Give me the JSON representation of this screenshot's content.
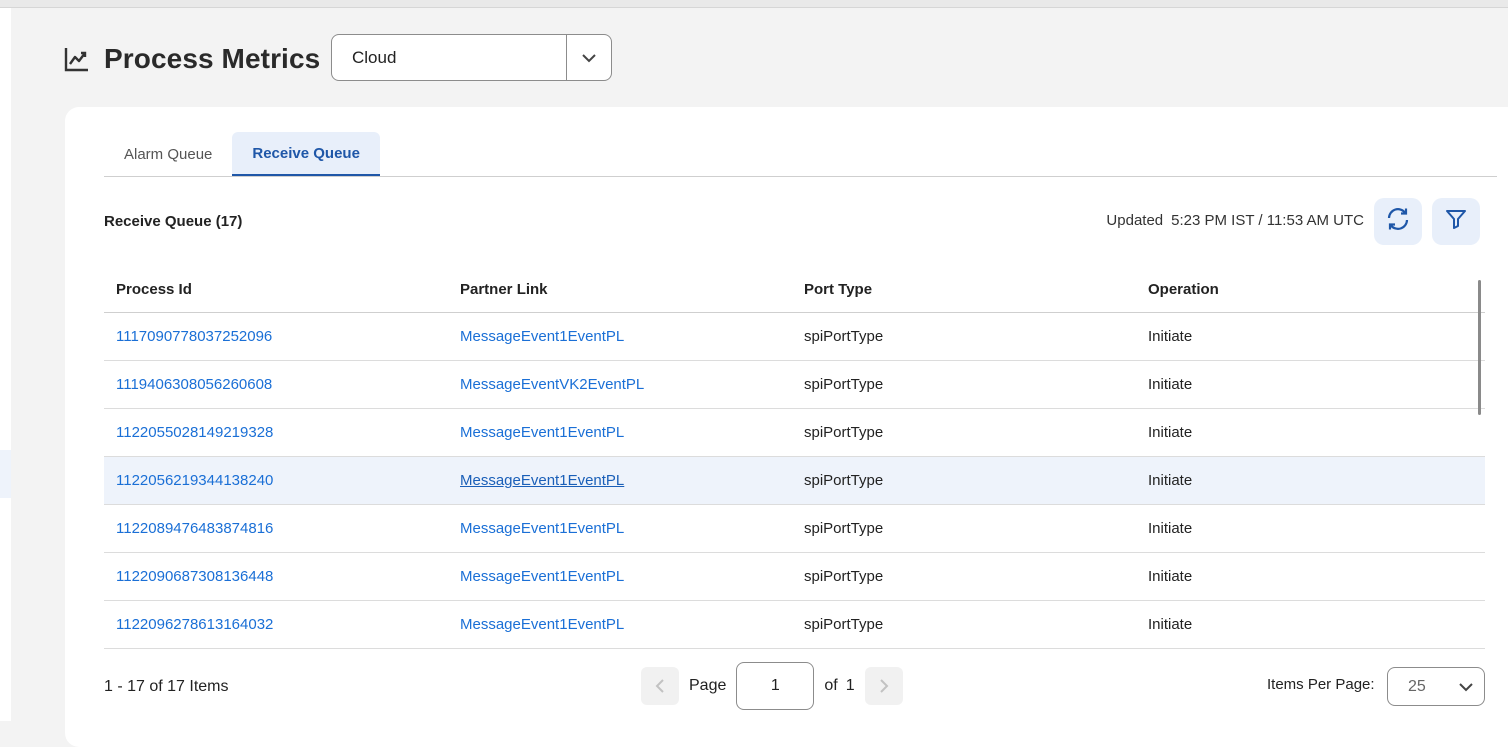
{
  "header": {
    "title": "Process Metrics",
    "title_icon": "line-chart-icon"
  },
  "environment_select": {
    "value": "Cloud",
    "icon": "chevron-down-icon"
  },
  "tabs": [
    {
      "label": "Alarm Queue",
      "active": false
    },
    {
      "label": "Receive Queue",
      "active": true
    }
  ],
  "queue": {
    "title": "Receive Queue (17)",
    "updated_label": "Updated",
    "updated_time": "5:23 PM IST / 11:53 AM UTC",
    "refresh_icon": "refresh-icon",
    "filter_icon": "filter-icon"
  },
  "table": {
    "columns": [
      "Process Id",
      "Partner Link",
      "Port Type",
      "Operation"
    ],
    "rows": [
      [
        "1117090778037252096",
        "MessageEvent1EventPL",
        "spiPortType",
        "Initiate"
      ],
      [
        "1119406308056260608",
        "MessageEventVK2EventPL",
        "spiPortType",
        "Initiate"
      ],
      [
        "1122055028149219328",
        "MessageEvent1EventPL",
        "spiPortType",
        "Initiate"
      ],
      [
        "1122056219344138240",
        "MessageEvent1EventPL",
        "spiPortType",
        "Initiate"
      ],
      [
        "1122089476483874816",
        "MessageEvent1EventPL",
        "spiPortType",
        "Initiate"
      ],
      [
        "1122090687308136448",
        "MessageEvent1EventPL",
        "spiPortType",
        "Initiate"
      ],
      [
        "1122096278613164032",
        "MessageEvent1EventPL",
        "spiPortType",
        "Initiate"
      ]
    ],
    "highlighted_row": 3
  },
  "footer": {
    "count": "1 - 17 of 17 Items",
    "page_label": "Page",
    "page_value": "1",
    "of_label": "of",
    "total_pages": "1",
    "items_per_page_label": "Items Per Page:",
    "items_per_page_value": "25"
  },
  "colors": {
    "accent": "#1f57a8",
    "link": "#1a6fd6",
    "tab_active_bg": "#e8effa",
    "row_highlight": "#eef3fb"
  }
}
